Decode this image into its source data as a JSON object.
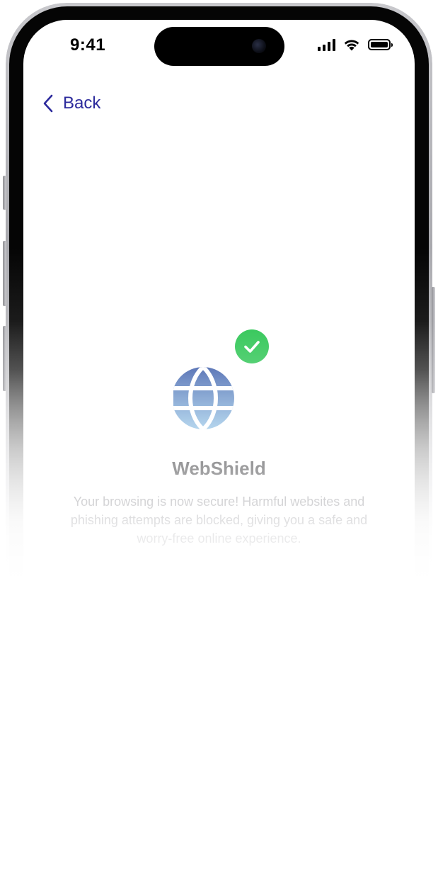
{
  "status_bar": {
    "time": "9:41"
  },
  "navigation": {
    "back_label": "Back"
  },
  "feature": {
    "title": "WebShield",
    "description": "Your browsing is now secure! Harmful websites and phishing attempts are blocked, giving you a safe and worry-free online experience.",
    "icon": "globe-icon",
    "status_icon": "checkmark-icon"
  },
  "colors": {
    "accent": "#2c2a9c",
    "success": "#34c759",
    "globe_top": "#3b5aa8",
    "globe_bottom": "#7fb7e0"
  }
}
